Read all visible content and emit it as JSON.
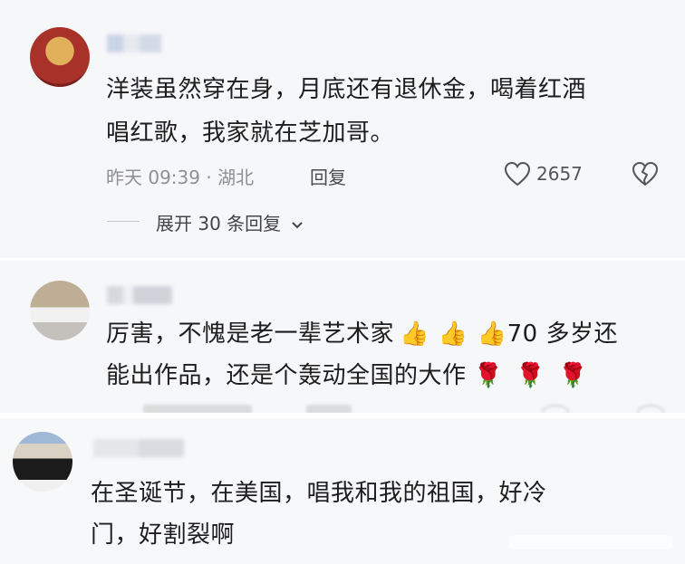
{
  "comments": [
    {
      "text_lines": [
        "洋装虽然穿在身，月底还有退休金，喝着红酒",
        "唱红歌，我家就在芝加哥。"
      ],
      "time": "昨天 09:39",
      "location": "湖北",
      "reply_label": "回复",
      "like_count": "2657",
      "expand_label": "展开 30 条回复"
    },
    {
      "text_line1_a": "厉害，不愧是老一辈艺术家",
      "text_line1_b": "70 多岁还",
      "text_line2": "能出作品，还是个轰动全国的大作",
      "thumbs_emoji": "👍",
      "rose_emoji": "🌹"
    },
    {
      "text_lines": [
        "在圣诞节，在美国，唱我和我的祖国，好冷",
        "门，好割裂啊"
      ]
    }
  ],
  "icons": {
    "like": "heart-outline-icon",
    "dislike": "broken-heart-icon",
    "expand": "chevron-down-icon"
  },
  "colors": {
    "meta": "#8f8f8f",
    "background": "#f6f7f9"
  }
}
